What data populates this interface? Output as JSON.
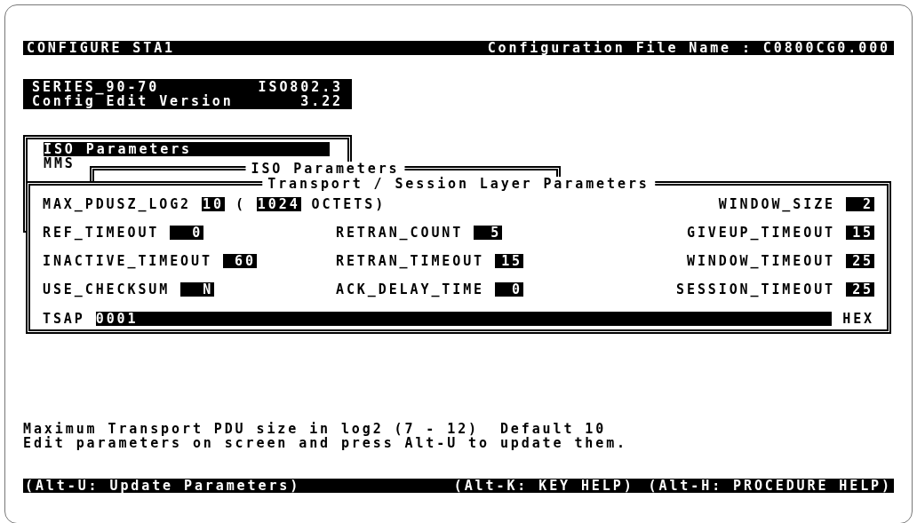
{
  "header": {
    "title": "CONFIGURE STA1",
    "file_label": "Configuration File Name : C0800CG0.000"
  },
  "version_box": {
    "lines": [
      [
        "SERIES_90-70",
        "ISO802.3"
      ],
      [
        "Config Edit Version",
        "3.22"
      ]
    ]
  },
  "menu": {
    "items": [
      {
        "label": "ISO Parameters",
        "selected": true
      },
      {
        "label": "MMS",
        "selected": false
      }
    ]
  },
  "iso_window": {
    "title": "ISO Parameters"
  },
  "transport_window": {
    "title": "Transport / Session Layer Parameters",
    "rows": [
      {
        "items": [
          {
            "kind": "pdu_size",
            "label": "MAX_PDUSZ_LOG2",
            "value": "10",
            "open": "(",
            "size": "1024",
            "unit": "OCTETS)"
          },
          {
            "kind": "param",
            "label": "WINDOW_SIZE",
            "value": "2"
          }
        ]
      },
      {
        "items": [
          {
            "kind": "param",
            "label": "REF_TIMEOUT",
            "value": "0"
          },
          {
            "kind": "param",
            "label": "RETRAN_COUNT",
            "value": "5"
          },
          {
            "kind": "param",
            "label": "GIVEUP_TIMEOUT",
            "value": "15"
          }
        ]
      },
      {
        "items": [
          {
            "kind": "param",
            "label": "INACTIVE_TIMEOUT",
            "value": "60"
          },
          {
            "kind": "param",
            "label": "RETRAN_TIMEOUT",
            "value": "15"
          },
          {
            "kind": "param",
            "label": "WINDOW_TIMEOUT",
            "value": "25"
          }
        ]
      },
      {
        "items": [
          {
            "kind": "param",
            "label": "USE_CHECKSUM",
            "value": "N"
          },
          {
            "kind": "param",
            "label": "ACK_DELAY_TIME",
            "value": "0"
          },
          {
            "kind": "param",
            "label": "SESSION_TIMEOUT",
            "value": "25"
          }
        ]
      }
    ],
    "tsap": {
      "label": "TSAP",
      "value": "0001",
      "unit": "HEX"
    }
  },
  "messages": [
    "Maximum Transport PDU size in log2 (7 - 12)  Default 10",
    "Edit parameters on screen and press Alt-U to update them."
  ],
  "key_bar": {
    "left": [
      "(Alt-U: Update Parameters)"
    ],
    "right": [
      "(Alt-K: KEY HELP)",
      "(Alt-H: PROCEDURE HELP)"
    ]
  }
}
